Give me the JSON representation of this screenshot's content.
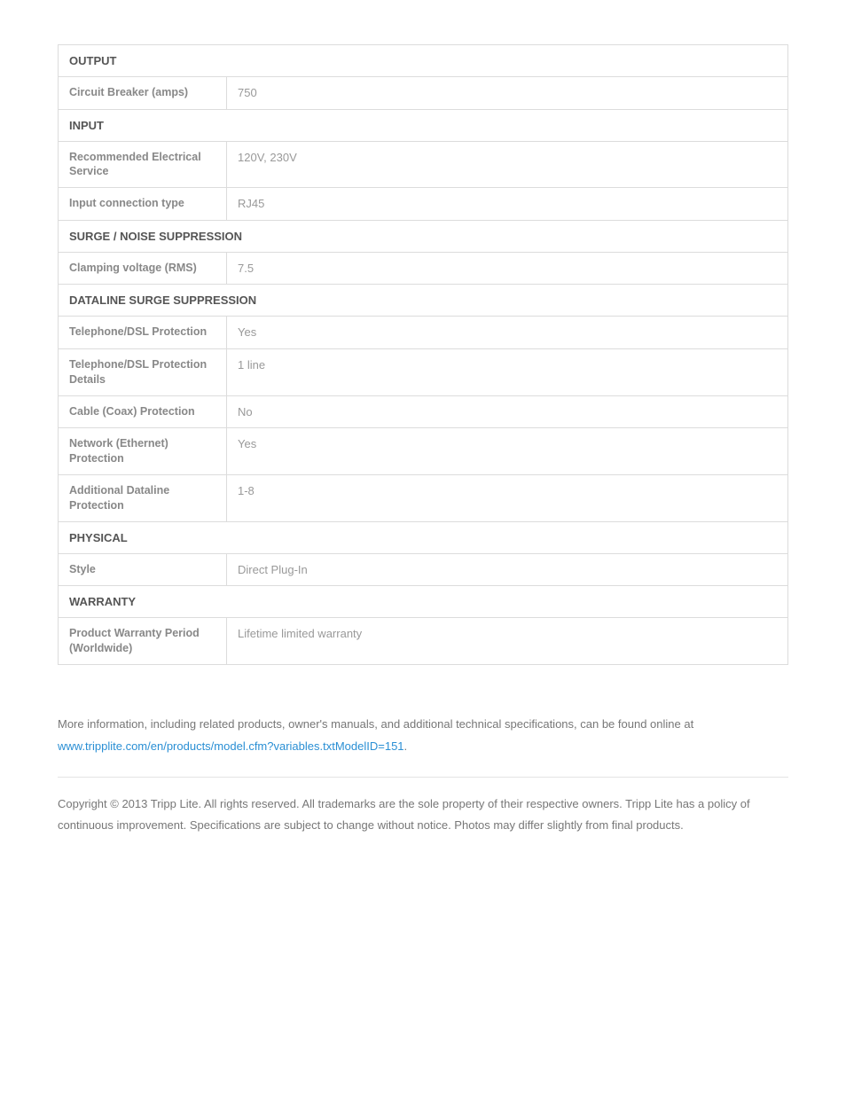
{
  "sections": {
    "output": {
      "header": "OUTPUT",
      "circuit_breaker_label": "Circuit Breaker (amps)",
      "circuit_breaker_value": "750"
    },
    "input": {
      "header": "INPUT",
      "rec_elec_label": "Recommended Electrical Service",
      "rec_elec_value": "120V, 230V",
      "conn_type_label": "Input connection type",
      "conn_type_value": "RJ45"
    },
    "surge": {
      "header": "SURGE / NOISE SUPPRESSION",
      "clamping_label": "Clamping voltage (RMS)",
      "clamping_value": "7.5"
    },
    "dataline": {
      "header": "DATALINE SURGE SUPPRESSION",
      "tel_label": "Telephone/DSL Protection",
      "tel_value": "Yes",
      "tel_details_label": "Telephone/DSL Protection Details",
      "tel_details_value": "1 line",
      "coax_label": "Cable (Coax) Protection",
      "coax_value": "No",
      "eth_label": "Network (Ethernet) Protection",
      "eth_value": "Yes",
      "add_label": "Additional Dataline Protection",
      "add_value": "1-8"
    },
    "physical": {
      "header": "PHYSICAL",
      "style_label": "Style",
      "style_value": "Direct Plug-In"
    },
    "warranty": {
      "header": "WARRANTY",
      "period_label": "Product Warranty Period (Worldwide)",
      "period_value": "Lifetime limited warranty"
    }
  },
  "footer": {
    "more_info": "More information, including related products, owner's manuals, and additional technical specifications, can be found online at ",
    "link_text": "www.tripplite.com/en/products/model.cfm?variables.txtModelID=151",
    "period": ".",
    "copyright": "Copyright © 2013 Tripp Lite. All rights reserved. All trademarks are the sole property of their respective owners. Tripp Lite has a policy of continuous improvement. Specifications are subject to change without notice. Photos may differ slightly from final products."
  }
}
